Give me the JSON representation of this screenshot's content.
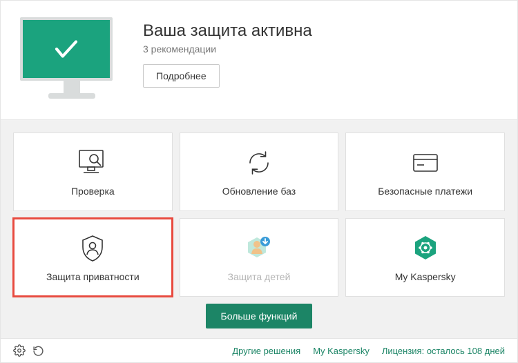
{
  "header": {
    "title": "Ваша защита активна",
    "subtitle": "3 рекомендации",
    "details_button": "Подробнее"
  },
  "tiles": [
    {
      "label": "Проверка",
      "icon": "scan",
      "disabled": false,
      "highlighted": false
    },
    {
      "label": "Обновление баз",
      "icon": "update",
      "disabled": false,
      "highlighted": false
    },
    {
      "label": "Безопасные платежи",
      "icon": "card",
      "disabled": false,
      "highlighted": false
    },
    {
      "label": "Защита приватности",
      "icon": "privacy",
      "disabled": false,
      "highlighted": true
    },
    {
      "label": "Защита детей",
      "icon": "kids",
      "disabled": true,
      "highlighted": false
    },
    {
      "label": "My Kaspersky",
      "icon": "mykaspersky",
      "disabled": false,
      "highlighted": false
    }
  ],
  "more_button": "Больше функций",
  "footer": {
    "links": [
      "Другие решения",
      "My Kaspersky",
      "Лицензия: осталось 108 дней"
    ]
  },
  "colors": {
    "accent": "#1c8566",
    "screen": "#1ba37e",
    "highlight": "#e84a3f"
  }
}
